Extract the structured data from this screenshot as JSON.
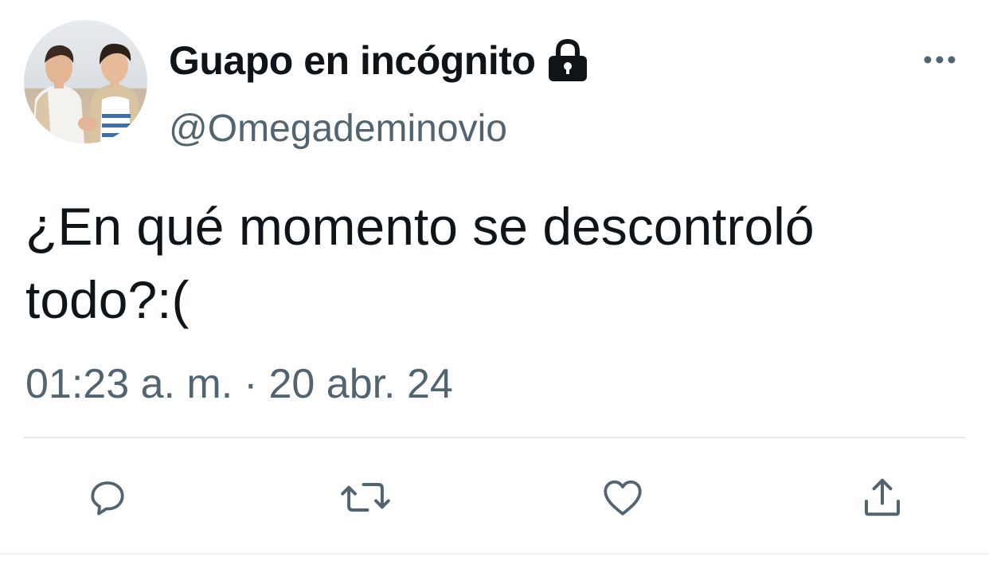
{
  "user": {
    "display_name": "Guapo en incógnito",
    "handle": "@Omegademinovio",
    "protected": true
  },
  "tweet": {
    "text": "¿En qué momento se descontroló todo?:(",
    "time": "01:23 a. m.",
    "separator": "·",
    "date": "20 abr. 24"
  },
  "icons": {
    "lock": "lock-icon",
    "more": "more-icon",
    "reply": "reply-icon",
    "retweet": "retweet-icon",
    "like": "heart-icon",
    "share": "share-icon"
  },
  "colors": {
    "text_primary": "#0f1419",
    "text_secondary": "#536471",
    "icon": "#536471",
    "divider": "#e6e9eb",
    "background": "#ffffff"
  }
}
